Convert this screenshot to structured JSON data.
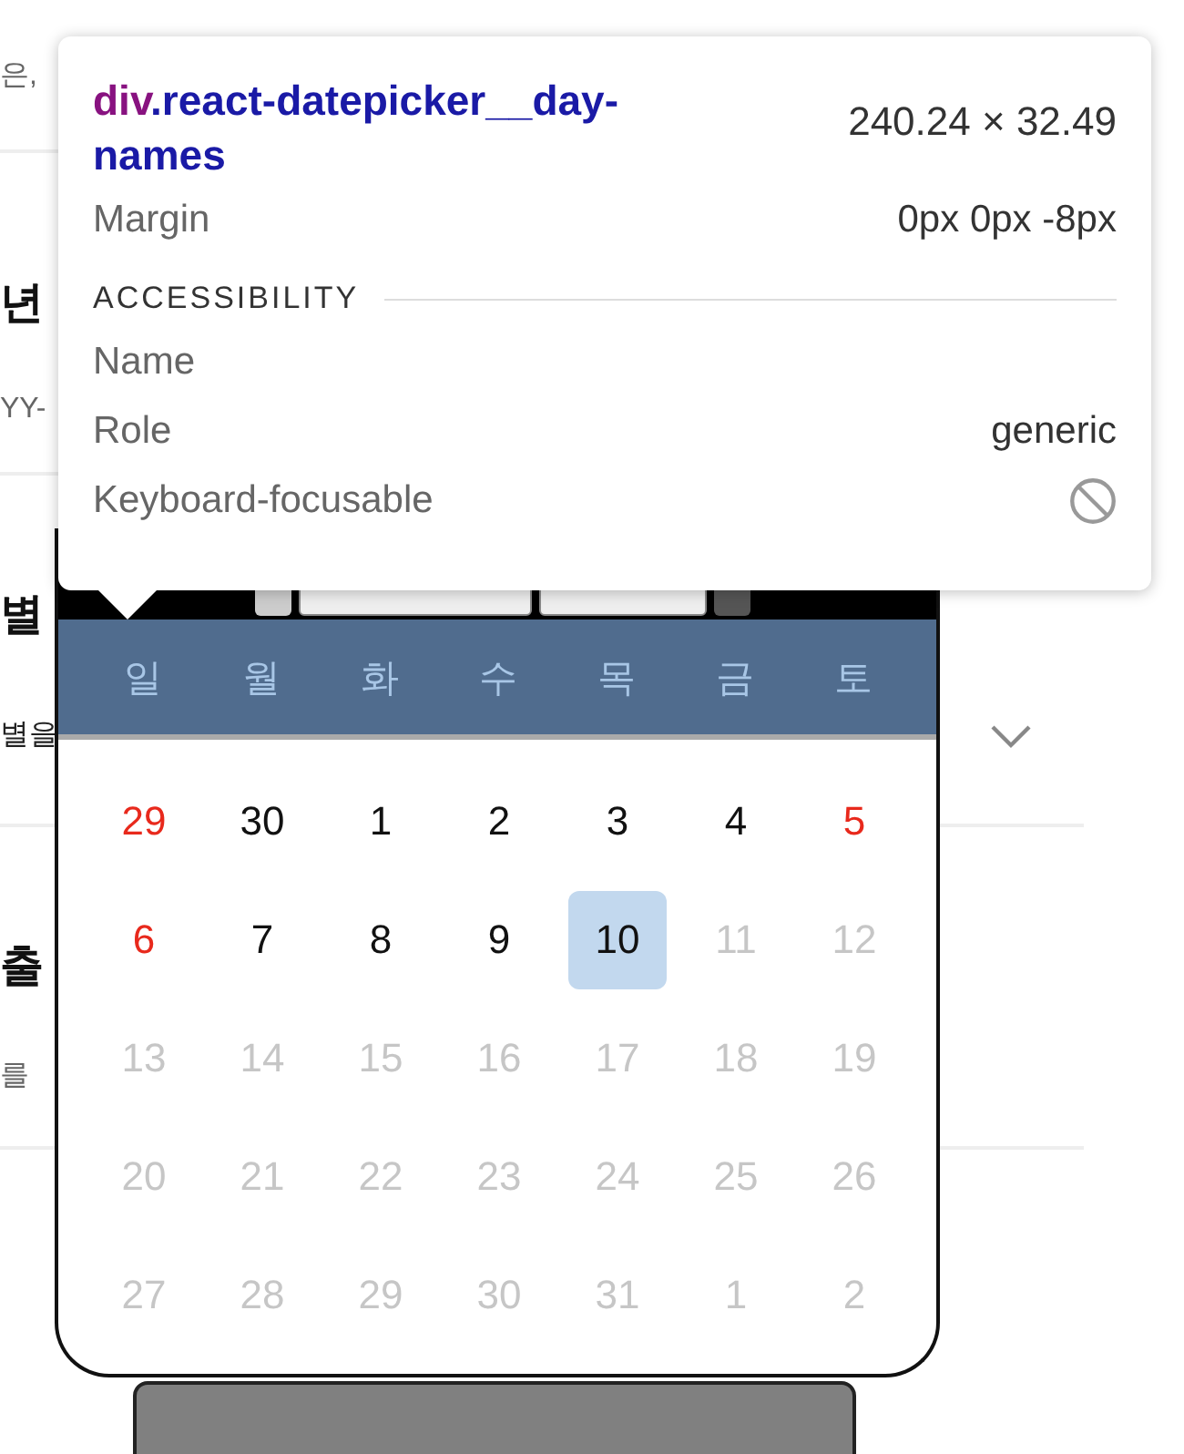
{
  "page": {
    "sections": [
      {
        "note": "은,"
      },
      {
        "heading": "년",
        "note": "YY-"
      },
      {
        "heading": "별",
        "note": "별을",
        "dropdown": true
      },
      {
        "heading": "출",
        "note": "를"
      }
    ]
  },
  "datepicker": {
    "day_names": [
      "일",
      "월",
      "화",
      "수",
      "목",
      "금",
      "토"
    ],
    "weeks": [
      [
        {
          "label": "29",
          "kind": "weekend",
          "selected": false
        },
        {
          "label": "30",
          "kind": "normal",
          "selected": false
        },
        {
          "label": "1",
          "kind": "normal",
          "selected": false
        },
        {
          "label": "2",
          "kind": "normal",
          "selected": false
        },
        {
          "label": "3",
          "kind": "normal",
          "selected": false
        },
        {
          "label": "4",
          "kind": "normal",
          "selected": false
        },
        {
          "label": "5",
          "kind": "weekend",
          "selected": false
        }
      ],
      [
        {
          "label": "6",
          "kind": "weekend",
          "selected": false
        },
        {
          "label": "7",
          "kind": "normal",
          "selected": false
        },
        {
          "label": "8",
          "kind": "normal",
          "selected": false
        },
        {
          "label": "9",
          "kind": "normal",
          "selected": false
        },
        {
          "label": "10",
          "kind": "normal",
          "selected": true
        },
        {
          "label": "11",
          "kind": "disabled",
          "selected": false
        },
        {
          "label": "12",
          "kind": "disabled",
          "selected": false
        }
      ],
      [
        {
          "label": "13",
          "kind": "disabled",
          "selected": false
        },
        {
          "label": "14",
          "kind": "disabled",
          "selected": false
        },
        {
          "label": "15",
          "kind": "disabled",
          "selected": false
        },
        {
          "label": "16",
          "kind": "disabled",
          "selected": false
        },
        {
          "label": "17",
          "kind": "disabled",
          "selected": false
        },
        {
          "label": "18",
          "kind": "disabled",
          "selected": false
        },
        {
          "label": "19",
          "kind": "disabled",
          "selected": false
        }
      ],
      [
        {
          "label": "20",
          "kind": "disabled",
          "selected": false
        },
        {
          "label": "21",
          "kind": "disabled",
          "selected": false
        },
        {
          "label": "22",
          "kind": "disabled",
          "selected": false
        },
        {
          "label": "23",
          "kind": "disabled",
          "selected": false
        },
        {
          "label": "24",
          "kind": "disabled",
          "selected": false
        },
        {
          "label": "25",
          "kind": "disabled",
          "selected": false
        },
        {
          "label": "26",
          "kind": "disabled",
          "selected": false
        }
      ],
      [
        {
          "label": "27",
          "kind": "disabled",
          "selected": false
        },
        {
          "label": "28",
          "kind": "disabled",
          "selected": false
        },
        {
          "label": "29",
          "kind": "disabled",
          "selected": false
        },
        {
          "label": "30",
          "kind": "disabled",
          "selected": false
        },
        {
          "label": "31",
          "kind": "disabled",
          "selected": false
        },
        {
          "label": "1",
          "kind": "disabled",
          "selected": false
        },
        {
          "label": "2",
          "kind": "disabled",
          "selected": false
        }
      ]
    ]
  },
  "inspector_tooltip": {
    "tag": "div",
    "class_name": ".react-datepicker__day-names",
    "size": "240.24 × 32.49",
    "properties": [
      {
        "label": "Margin",
        "value": "0px 0px -8px"
      }
    ],
    "section_title": "ACCESSIBILITY",
    "accessibility": [
      {
        "label": "Name",
        "kind": "text"
      },
      {
        "label": "Role",
        "kind": "text",
        "value": "generic"
      },
      {
        "label": "Keyboard-focusable",
        "kind": "blocked"
      }
    ]
  }
}
